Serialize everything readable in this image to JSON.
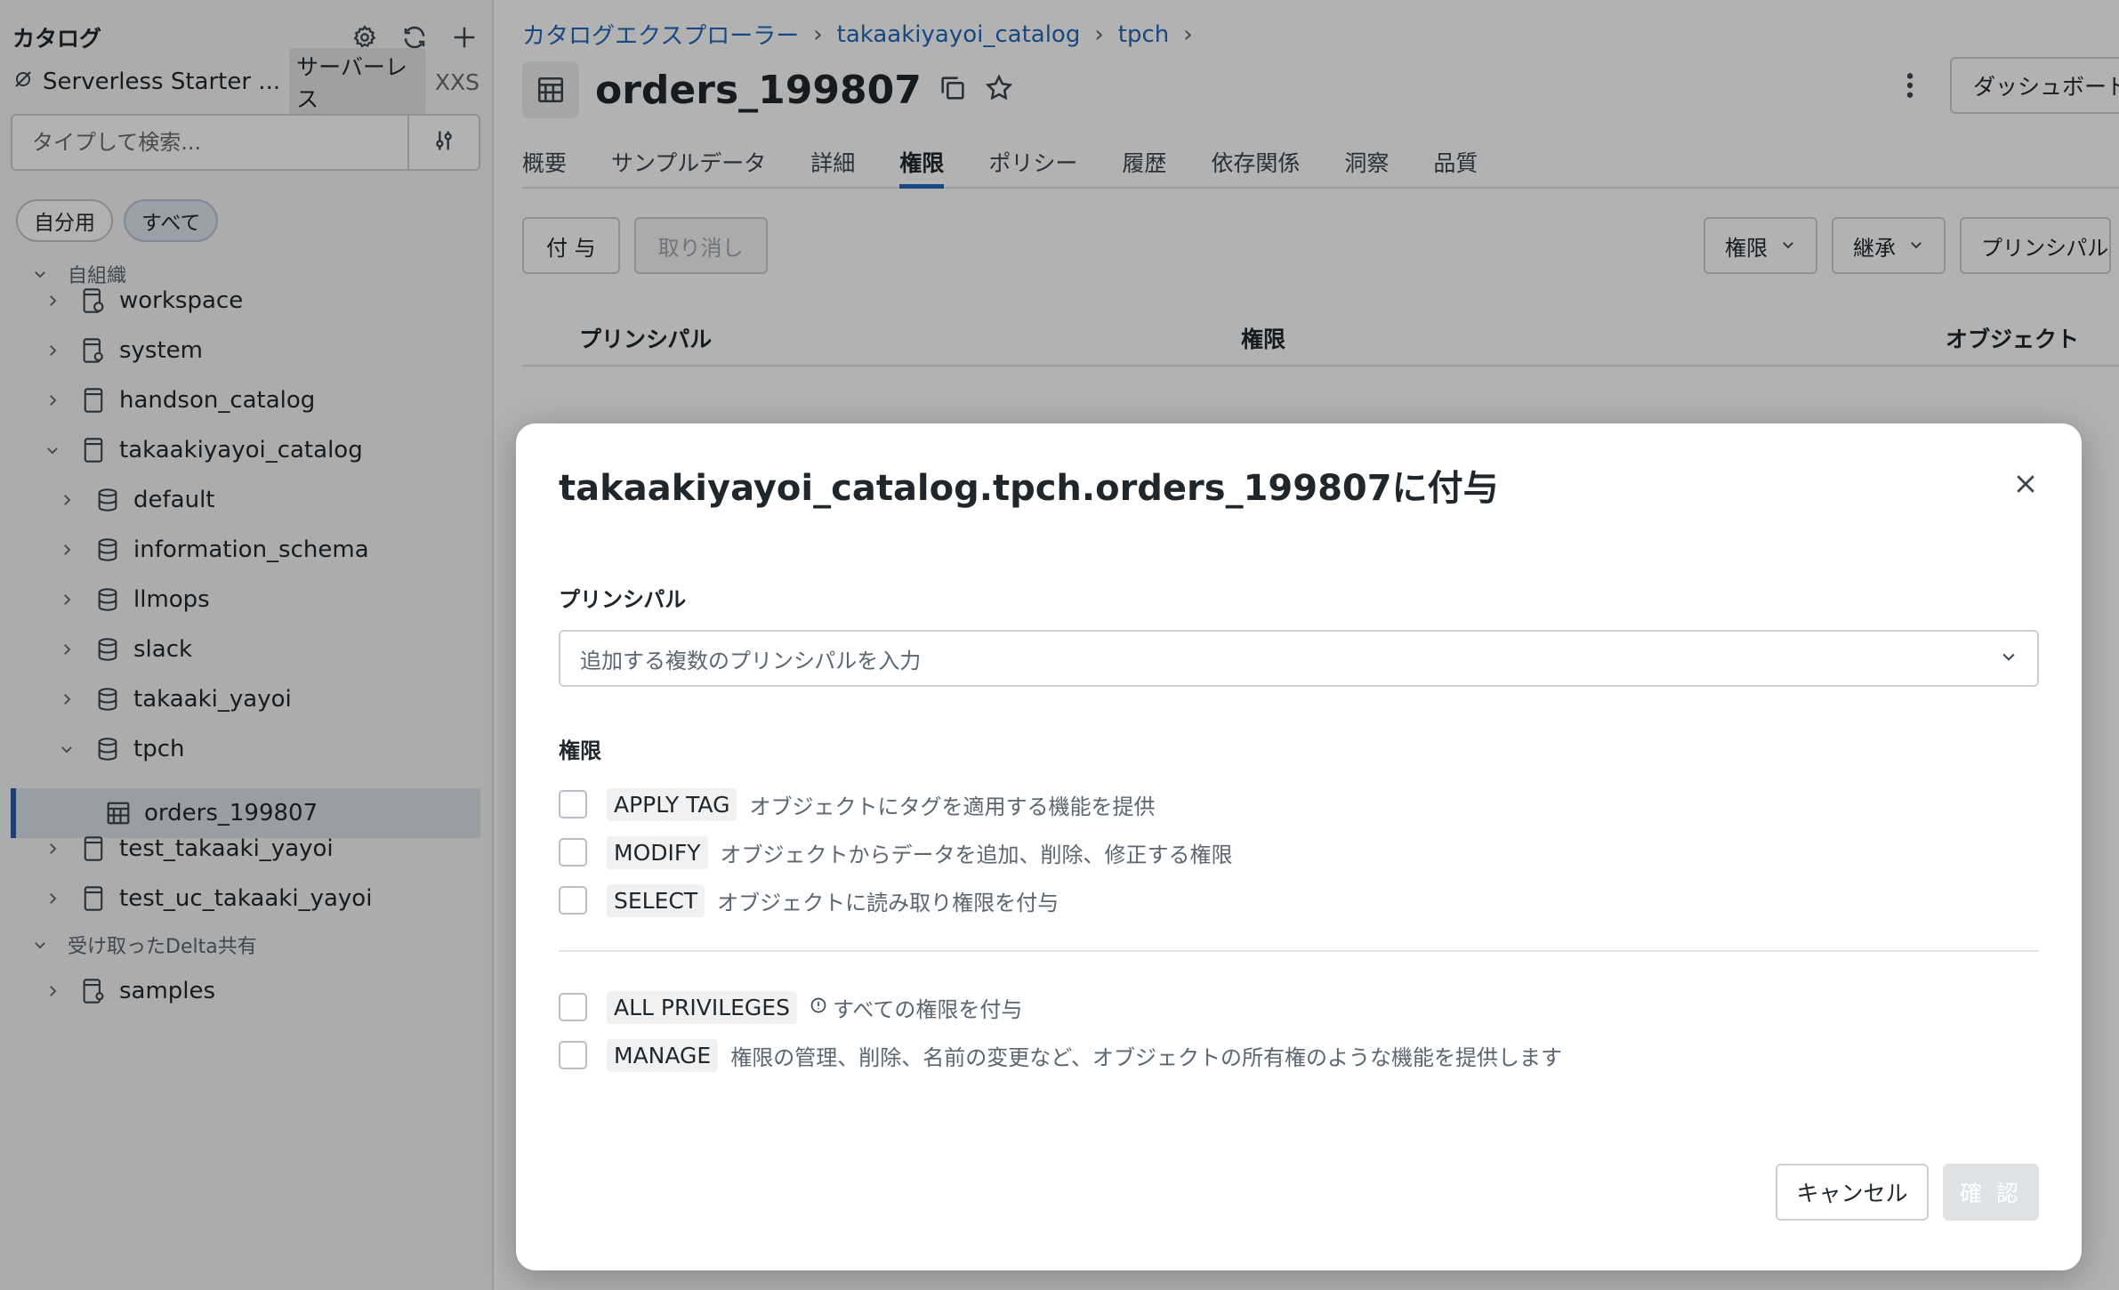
{
  "sidebar": {
    "title": "カタログ",
    "warehouse": {
      "name": "Serverless Starter ...",
      "type": "サーバーレス",
      "size": "XXS"
    },
    "search": {
      "placeholder": "タイプして検索..."
    },
    "chips": [
      "自分用",
      "すべて"
    ],
    "groups": {
      "my_org": "自組織",
      "delta_shared": "受け取ったDelta共有"
    },
    "items": {
      "workspace": "workspace",
      "system": "system",
      "handson_catalog": "handson_catalog",
      "takaakiyayoi_catalog": "takaakiyayoi_catalog",
      "default": "default",
      "information_schema": "information_schema",
      "llmops": "llmops",
      "slack": "slack",
      "takaaki_yayoi": "takaaki_yayoi",
      "tpch": "tpch",
      "orders_199807": "orders_199807",
      "test_takaaki_yayoi": "test_takaaki_yayoi",
      "test_uc_takaaki_yayoi": "test_uc_takaaki_yayoi",
      "samples": "samples"
    }
  },
  "main": {
    "breadcrumb": [
      "カタログエクスプローラー",
      "takaakiyayoi_catalog",
      "tpch"
    ],
    "title": "orders_199807",
    "dashboard_label": "ダッシュボード",
    "tabs": [
      "概要",
      "サンプルデータ",
      "詳細",
      "権限",
      "ポリシー",
      "履歴",
      "依存関係",
      "洞察",
      "品質"
    ],
    "active_tab": "権限",
    "buttons": {
      "grant": "付 与",
      "revoke": "取り消し"
    },
    "filters": {
      "privilege": "権限",
      "inherit": "継承",
      "principal": "プリンシパル"
    },
    "table_headers": {
      "principal": "プリンシパル",
      "privilege": "権限",
      "object": "オブジェクト"
    }
  },
  "modal": {
    "title": "takaakiyayoi_catalog.tpch.orders_199807に付与",
    "principal_label": "プリンシパル",
    "principal_placeholder": "追加する複数のプリンシパルを入力",
    "privileges_label": "権限",
    "privileges": [
      {
        "code": "APPLY TAG",
        "desc": "オブジェクトにタグを適用する機能を提供"
      },
      {
        "code": "MODIFY",
        "desc": "オブジェクトからデータを追加、削除、修正する権限"
      },
      {
        "code": "SELECT",
        "desc": "オブジェクトに読み取り権限を付与"
      }
    ],
    "special_privileges": [
      {
        "code": "ALL PRIVILEGES",
        "desc": "すべての権限を付与"
      },
      {
        "code": "MANAGE",
        "desc": "権限の管理、削除、名前の変更など、オブジェクトの所有権のような機能を提供します"
      }
    ],
    "cancel_label": "キャンセル",
    "confirm_label": "確 認"
  },
  "colors": {
    "accent": "#2268b9",
    "selected_bg": "#dbe3ec",
    "overlay": "#000000"
  }
}
